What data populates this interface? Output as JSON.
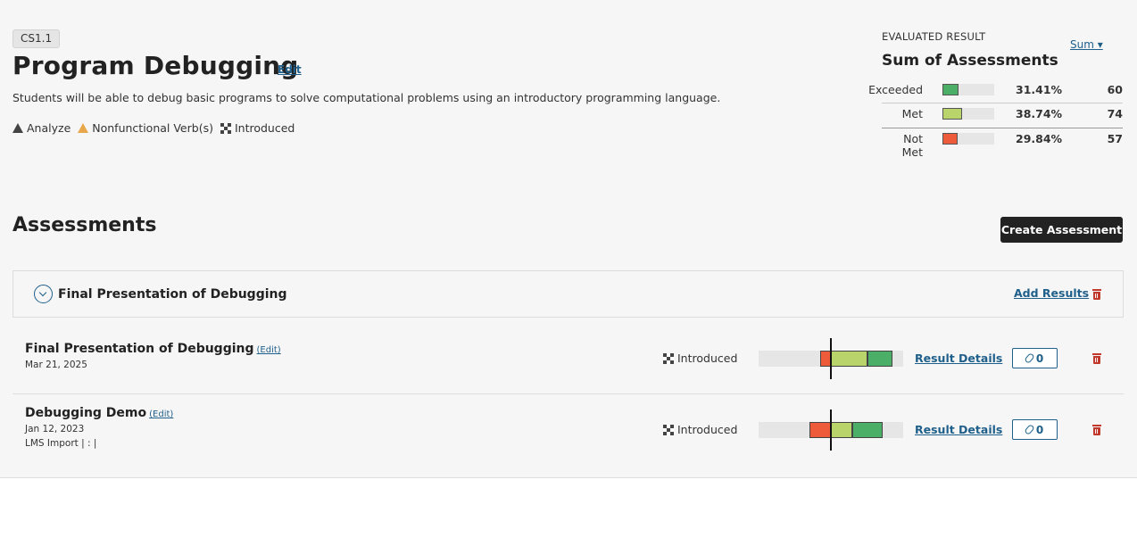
{
  "outcome": {
    "code": "CS1.1",
    "title": "Program Debugging",
    "edit_label": "Edit",
    "description": "Students will be able to debug basic programs to solve computational problems using an introductory programming language.",
    "tags": [
      {
        "label": "Analyze",
        "icon": "bloom-triangle-icon",
        "color": "#444444"
      },
      {
        "label": "Nonfunctional Verb(s)",
        "icon": "warning-triangle-icon",
        "color": "#e8a74b"
      },
      {
        "label": "Introduced",
        "icon": "checker-icon"
      }
    ]
  },
  "evaluated": {
    "label": "EVALUATED RESULT",
    "title": "Sum of Assessments",
    "sum_link": "Sum ▾",
    "rows": [
      {
        "label": "Exceeded",
        "percent": "31.41%",
        "fraction": 0.3141,
        "count": "60",
        "color": "#4caf67"
      },
      {
        "label": "Met",
        "percent": "38.74%",
        "fraction": 0.3874,
        "count": "74",
        "color": "#b8d46b"
      },
      {
        "label": "Not Met",
        "percent": "29.84%",
        "fraction": 0.2984,
        "count": "57",
        "color": "#ee5b3a"
      }
    ]
  },
  "assessments": {
    "title": "Assessments",
    "create_label": "Create Assessment",
    "group": {
      "title": "Final Presentation of Debugging",
      "add_results_label": "Add Results"
    },
    "items": [
      {
        "title": "Final Presentation of Debugging",
        "edit_label": "(Edit)",
        "date": "Mar 21, 2025",
        "meta": "",
        "level": "Introduced",
        "dist": {
          "not_met": 0.0719,
          "met": 0.2532,
          "exceeded": 0.1725
        },
        "result_details_label": "Result Details",
        "attachments": "0"
      },
      {
        "title": "Debugging Demo",
        "edit_label": "(Edit)",
        "date": "Jan 12, 2023",
        "meta": "LMS Import | : |",
        "level": "Introduced",
        "dist": {
          "not_met": 0.1488,
          "met": 0.1458,
          "exceeded": 0.2113
        },
        "result_details_label": "Result Details",
        "attachments": "0"
      }
    ]
  },
  "colors": {
    "link": "#1f5f8b",
    "danger": "#c0392b",
    "not_met": "#ee5b3a",
    "met": "#b8d46b",
    "exceeded": "#4caf67"
  }
}
